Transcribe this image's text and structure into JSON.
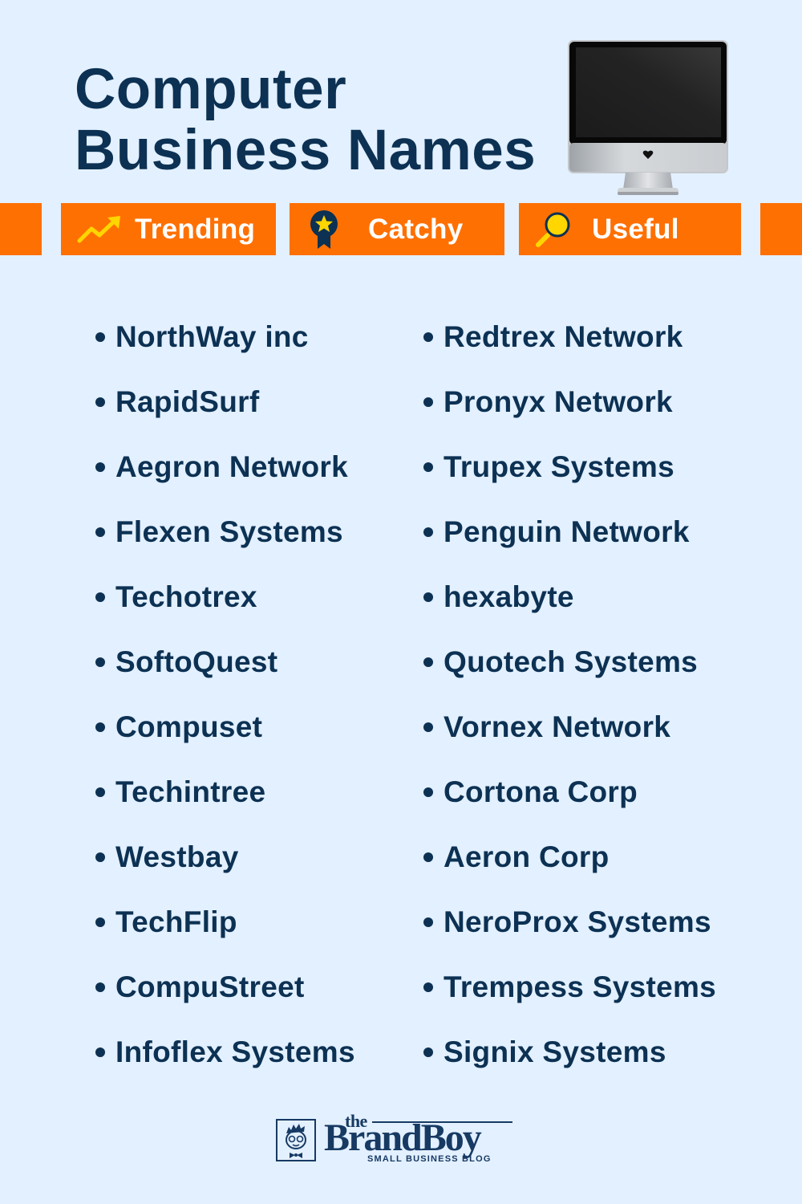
{
  "header": {
    "title_line1": "Computer",
    "title_line2": "Business Names",
    "illustration": "desktop-monitor"
  },
  "tags": [
    {
      "label": "Trending",
      "icon": "trending-up-arrow-icon"
    },
    {
      "label": "Catchy",
      "icon": "award-ribbon-star-icon"
    },
    {
      "label": "Useful",
      "icon": "magnifying-glass-icon"
    }
  ],
  "colors": {
    "background": "#e3f0ff",
    "accent": "#ff7002",
    "text": "#0c3153",
    "icon_yellow": "#ffd600"
  },
  "names_left": [
    "NorthWay inc",
    "RapidSurf",
    "Aegron Network",
    "Flexen Systems",
    "Techotrex",
    "SoftoQuest",
    "Compuset",
    "Techintree",
    "Westbay",
    "TechFlip",
    "CompuStreet",
    "Infoflex Systems"
  ],
  "names_right": [
    "Redtrex Network",
    "Pronyx Network",
    "Trupex Systems",
    "Penguin Network",
    "hexabyte",
    "Quotech Systems",
    "Vornex Network",
    "Cortona Corp",
    "Aeron Corp",
    "NeroProx Systems",
    "Trempess Systems",
    "Signix Systems"
  ],
  "footer": {
    "logo_the": "the",
    "logo_brand": "BrandBoy",
    "logo_tagline": "SMALL BUSINESS BLOG"
  }
}
